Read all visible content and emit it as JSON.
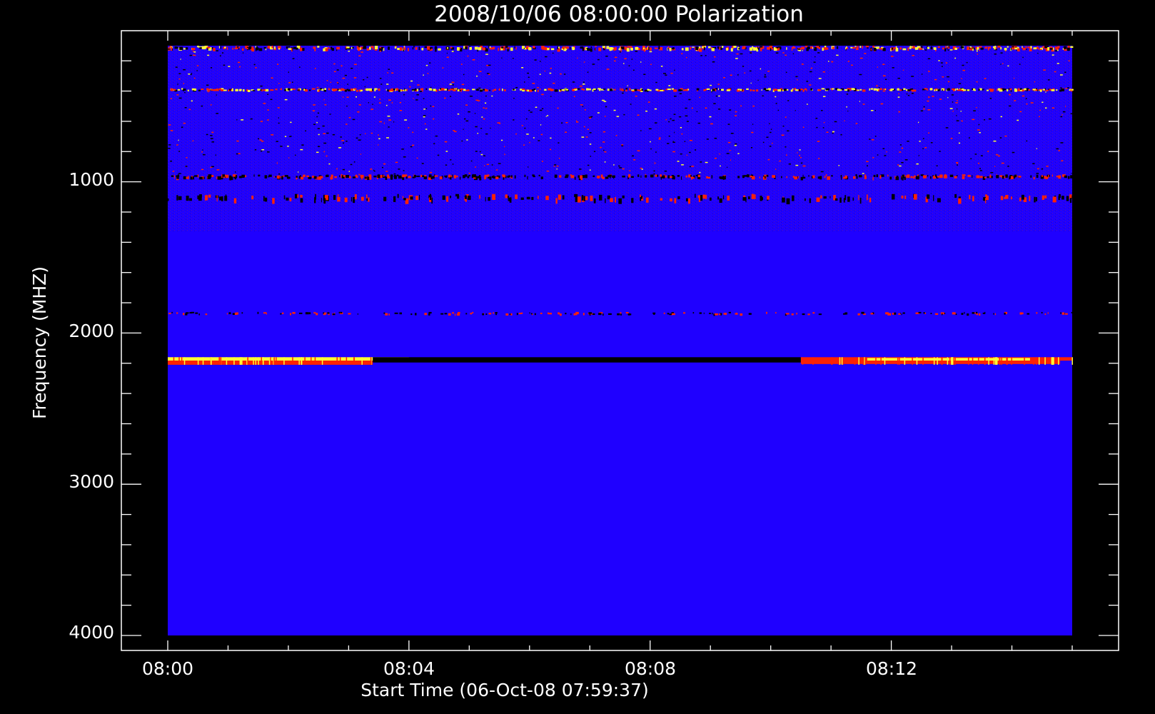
{
  "chart_data": {
    "type": "heatmap",
    "title": "2008/10/06 08:00:00 Polarization",
    "xlabel": "Start Time (06-Oct-08 07:59:37)",
    "ylabel": "Frequency (MHZ)",
    "x_tick_labels": [
      "08:00",
      "08:04",
      "08:08",
      "08:12"
    ],
    "x_range_minutes": [
      0,
      15
    ],
    "y_tick_values": [
      1000,
      2000,
      3000,
      4000
    ],
    "y_range": [
      100,
      4000
    ],
    "y_axis_inverted": true,
    "grid": false,
    "colors": {
      "background": "#1f00ff",
      "hot": "#ffff33",
      "warm": "#ff2200",
      "dark": "#000000",
      "frame": "#ffffff"
    },
    "bands": [
      {
        "freq_from": 100,
        "freq_to": 130,
        "kind": "hot-noise"
      },
      {
        "freq_from": 380,
        "freq_to": 400,
        "kind": "hot-noise"
      },
      {
        "freq_from": 950,
        "freq_to": 980,
        "kind": "red-black-noise"
      },
      {
        "freq_from": 1080,
        "freq_to": 1130,
        "kind": "weak-noise"
      },
      {
        "freq_from": 1860,
        "freq_to": 1880,
        "kind": "weak-noise"
      },
      {
        "freq_from": 2160,
        "freq_to": 2210,
        "kind": "strong-emission"
      }
    ]
  }
}
